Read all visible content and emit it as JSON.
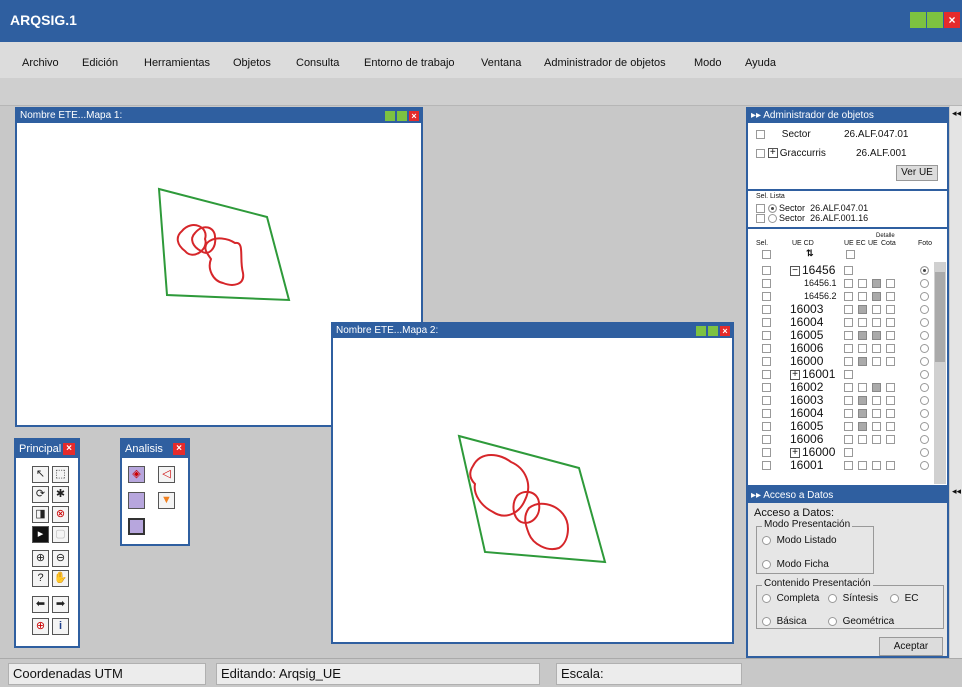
{
  "app": {
    "title": "ARQSIG.1"
  },
  "menu": [
    "Archivo",
    "Edición",
    "Herramientas",
    "Objetos",
    "Consulta",
    "Entorno de trabajo",
    "Ventana",
    "Administrador de objetos",
    "Modo",
    "Ayuda"
  ],
  "map1": {
    "title": "Nombre ETE...Mapa 1:"
  },
  "map2": {
    "title": "Nombre ETE...Mapa 2:"
  },
  "principal": {
    "title": "Principal"
  },
  "analisis": {
    "title": "Analisis"
  },
  "admin": {
    "title": "Administrador de objetos",
    "items": [
      {
        "label": "Sector",
        "code": "26.ALF.047.01"
      },
      {
        "label": "Graccurris",
        "code": "26.ALF.001"
      }
    ],
    "ver_ue": "Ver UE",
    "list_header": {
      "sel": "Sel.",
      "lista": "Lista"
    },
    "list": [
      {
        "label": "Sector",
        "code": "26.ALF.047.01"
      },
      {
        "label": "Sector",
        "code": "26.ALF.001.16"
      }
    ],
    "table_header": {
      "sel": "Sel.",
      "ue_cd": "UE CD",
      "detalle": "Detalle",
      "ue": "UE",
      "ec": "EC",
      "ue2": "UE",
      "cota": "Cota",
      "foto": "Foto",
      "sort": "⇅"
    },
    "rows": [
      {
        "code": "16456",
        "expander": "−",
        "sub": false
      },
      {
        "code": "16456.1",
        "expander": "",
        "sub": true
      },
      {
        "code": "16456.2",
        "expander": "",
        "sub": true
      },
      {
        "code": "16003",
        "expander": "",
        "sub": false
      },
      {
        "code": "16004",
        "expander": "",
        "sub": false
      },
      {
        "code": "16005",
        "expander": "",
        "sub": false
      },
      {
        "code": "16006",
        "expander": "",
        "sub": false
      },
      {
        "code": "16000",
        "expander": "",
        "sub": false
      },
      {
        "code": "16001",
        "expander": "+",
        "sub": false
      },
      {
        "code": "16002",
        "expander": "",
        "sub": false
      },
      {
        "code": "16003",
        "expander": "",
        "sub": false
      },
      {
        "code": "16004",
        "expander": "",
        "sub": false
      },
      {
        "code": "16005",
        "expander": "",
        "sub": false
      },
      {
        "code": "16006",
        "expander": "",
        "sub": false
      },
      {
        "code": "16000",
        "expander": "+",
        "sub": false
      },
      {
        "code": "16001",
        "expander": "",
        "sub": false
      }
    ]
  },
  "acceso": {
    "title": "Acceso a Datos",
    "heading": "Acceso a Datos:",
    "modo_label": "Modo Presentación",
    "modo_options": [
      "Modo Listado",
      "Modo Ficha"
    ],
    "contenido_label": "Contenido Presentación",
    "contenido_options": [
      "Completa",
      "Síntesis",
      "EC",
      "Básica",
      "Geométrica"
    ],
    "accept": "Aceptar"
  },
  "status": {
    "coords": "Coordenadas UTM",
    "editing": "Editando: Arqsig_UE",
    "scale": "Escala:"
  },
  "colors": {
    "title_blue": "#2f5fa0",
    "trapezoid_green": "#2e9a3a",
    "polygon_red": "#d6262a",
    "win_green": "#7dc241",
    "win_red": "#e52b2b"
  },
  "icons": [
    "arrow-icon",
    "select-icon",
    "zoom-in-icon",
    "zoom-out-icon",
    "hand-icon",
    "info-icon",
    "stop-icon",
    "left-arrow-icon",
    "right-arrow-icon",
    "crosshair-icon"
  ]
}
